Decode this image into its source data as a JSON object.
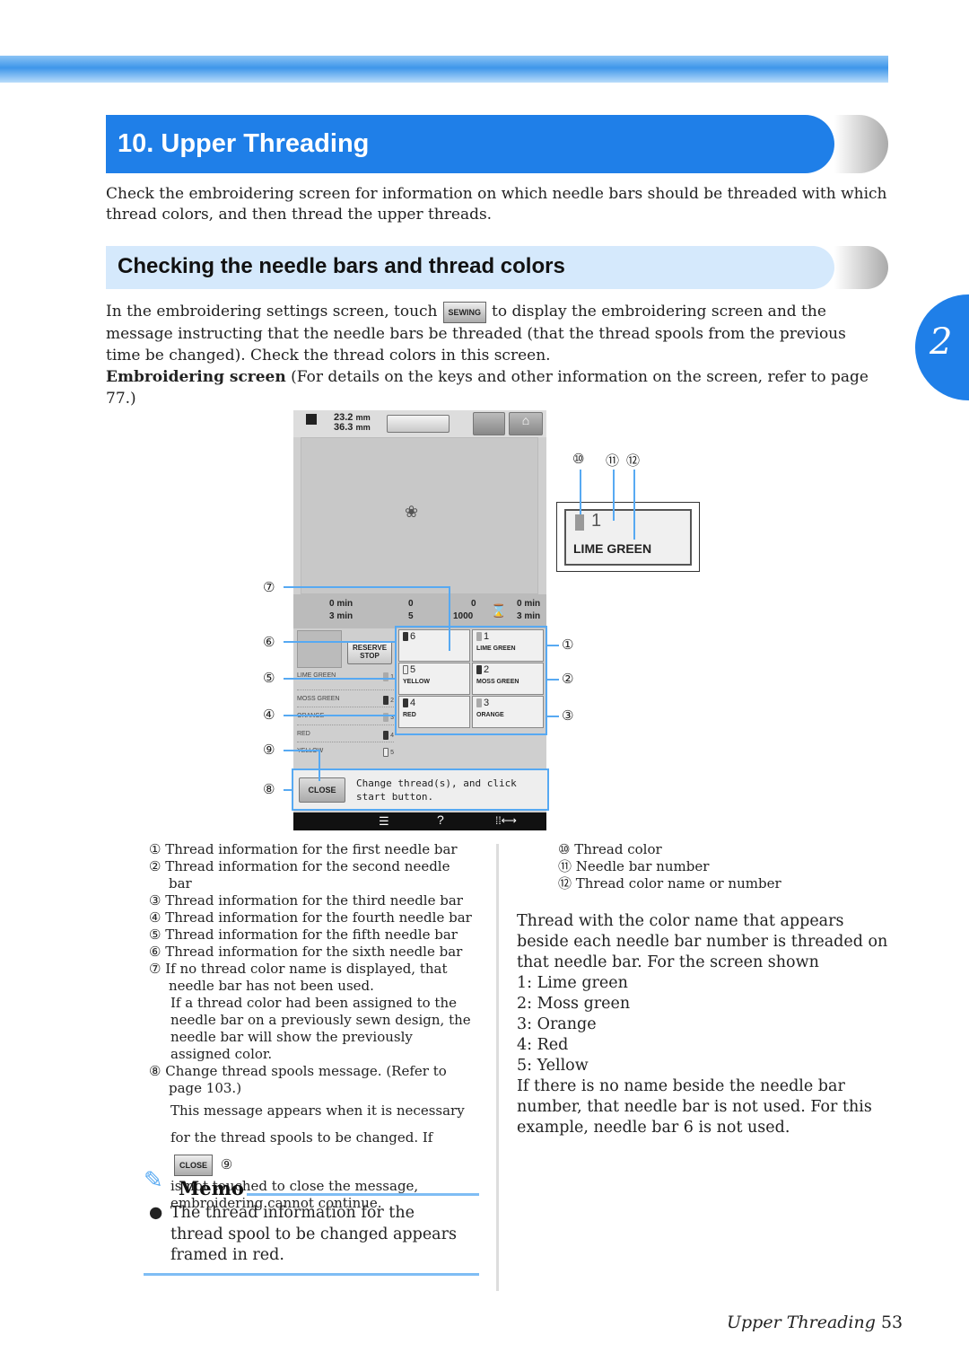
{
  "header": {
    "title": "10. Upper Threading",
    "intro": "Check the embroidering screen for information on which needle bars should be threaded with which thread colors, and then thread the upper threads."
  },
  "chapter_tab": "2",
  "section": {
    "title": "Checking the needle bars and thread colors",
    "p1_before": "In the embroidering settings screen, touch",
    "sewing_button": "SEWING",
    "p1_after": "to display the embroidering screen and the message instructing that the needle bars be threaded (that the thread spools from the previous time be changed). Check the thread colors in this screen.",
    "p2_bold": "Embroidering screen",
    "p2_rest": " (For details on the keys and other information on the screen, refer to page 77.)"
  },
  "screen": {
    "size_w": "23.2",
    "size_h": "36.3",
    "unit": "mm",
    "time_top": "0",
    "time_bottom": "3",
    "min": "min",
    "color_top": "0",
    "color_bottom": "5",
    "stitch_top": "0",
    "stitch_bottom": "1000",
    "total_top": "0",
    "total_bottom": "3",
    "reserve_stop": "RESERVE STOP",
    "color_list": [
      {
        "name": "LIME GREEN",
        "n": "1"
      },
      {
        "name": "MOSS GREEN",
        "n": "2"
      },
      {
        "name": "ORANGE",
        "n": "3"
      },
      {
        "name": "RED",
        "n": "4"
      },
      {
        "name": "YELLOW",
        "n": "5"
      }
    ],
    "needles": [
      {
        "n": "6",
        "name": ""
      },
      {
        "n": "1",
        "name": "LIME GREEN"
      },
      {
        "n": "5",
        "name": "YELLOW"
      },
      {
        "n": "2",
        "name": "MOSS GREEN"
      },
      {
        "n": "4",
        "name": "RED"
      },
      {
        "n": "3",
        "name": "ORANGE"
      }
    ],
    "close": "CLOSE",
    "message": "Change thread(s), and click start button.",
    "help": "?"
  },
  "zoom_box": {
    "n": "1",
    "name": "LIME GREEN"
  },
  "callouts": [
    "①",
    "②",
    "③",
    "④",
    "⑤",
    "⑥",
    "⑦",
    "⑧",
    "⑨",
    "⑩",
    "⑪",
    "⑫"
  ],
  "legend_left": [
    "① Thread information for the first needle bar",
    "② Thread information for the second needle bar",
    "③ Thread information for the third needle bar",
    "④ Thread information for the fourth needle bar",
    "⑤ Thread information for the fifth needle bar",
    "⑥ Thread information for the sixth needle bar",
    "⑦ If no thread color name is displayed, that needle bar has not been used.",
    "If a thread color had been assigned to the needle bar on a previously sewn design, the needle bar will show the previously assigned color.",
    "⑧ Change thread spools message. (Refer to page 103.)",
    "This message appears when it is necessary for the thread spools to be changed. If",
    "is not touched to close the message, embroidering cannot continue."
  ],
  "close_inline": "CLOSE",
  "nine": "⑨",
  "legend_right": [
    "⑩ Thread color",
    "⑪ Needle bar number",
    "⑫ Thread color name or number"
  ],
  "right_text": [
    "Thread with the color name that appears beside each needle bar number is threaded on that needle bar. For the screen shown",
    "1: Lime green",
    "2: Moss green",
    "3: Orange",
    "4: Red",
    "5: Yellow",
    "If there is no name beside the needle bar number, that needle bar is not used. For this example, needle bar 6 is not used."
  ],
  "memo": {
    "title": "Memo",
    "text": "The thread information for the thread spool to be changed appears framed in red."
  },
  "footer": {
    "section": "Upper Threading",
    "page": "53"
  }
}
